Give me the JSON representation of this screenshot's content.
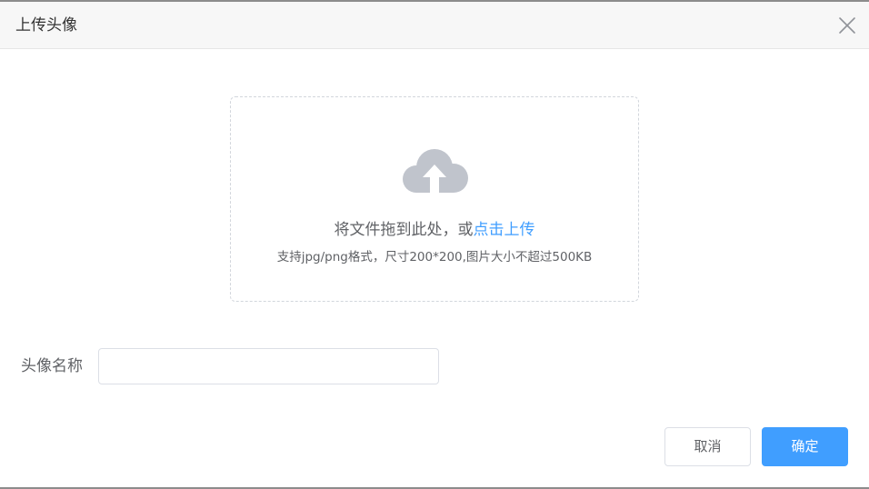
{
  "dialog": {
    "title": "上传头像",
    "close_icon": "close-icon"
  },
  "upload": {
    "icon": "cloud-upload-icon",
    "drag_text": "将文件拖到此处，或",
    "click_text": "点击上传",
    "hint": "支持jpg/png格式，尺寸200*200,图片大小不超过500KB"
  },
  "form": {
    "name_label": "头像名称",
    "name_value": "",
    "name_placeholder": ""
  },
  "footer": {
    "cancel_label": "取消",
    "confirm_label": "确定"
  },
  "colors": {
    "accent": "#409eff",
    "icon_gray": "#c0c4cc",
    "text": "#606266"
  }
}
